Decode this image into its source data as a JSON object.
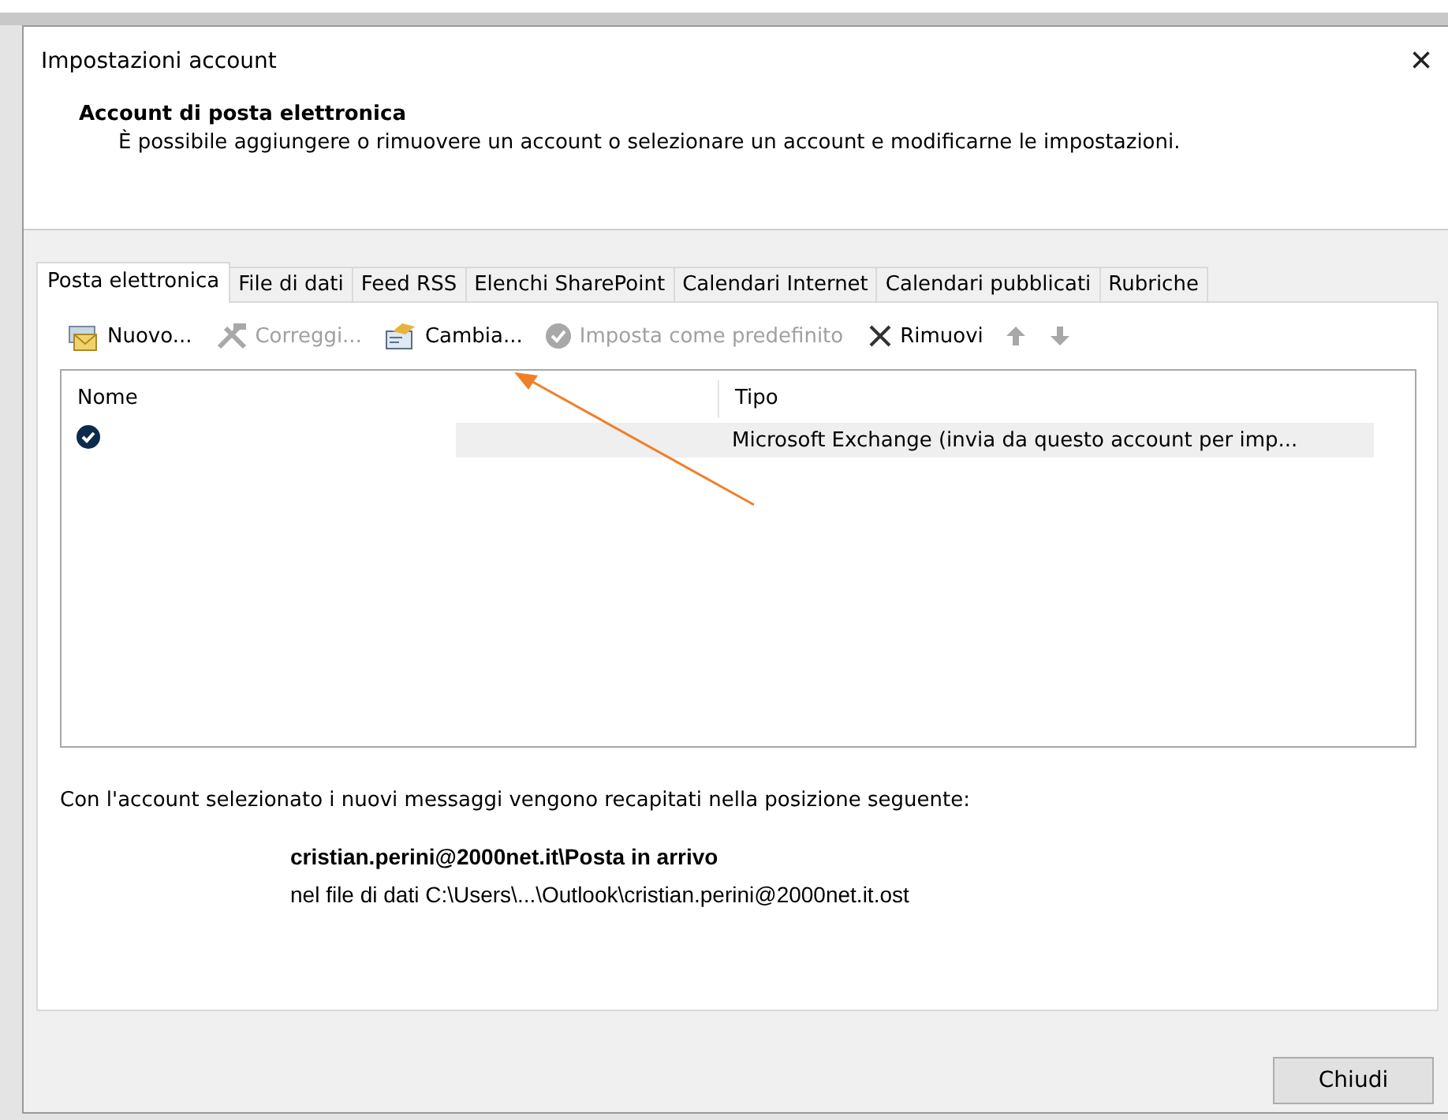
{
  "window": {
    "title": "Impostazioni account",
    "close": "×"
  },
  "header": {
    "title": "Account di posta elettronica",
    "description": "È possibile aggiungere o rimuovere un account o selezionare un account e modificarne le impostazioni."
  },
  "tabs": [
    {
      "label": "Posta elettronica",
      "selected": true
    },
    {
      "label": "File di dati",
      "selected": false
    },
    {
      "label": "Feed RSS",
      "selected": false
    },
    {
      "label": "Elenchi SharePoint",
      "selected": false
    },
    {
      "label": "Calendari Internet",
      "selected": false
    },
    {
      "label": "Calendari pubblicati",
      "selected": false
    },
    {
      "label": "Rubriche",
      "selected": false
    }
  ],
  "toolbar": [
    {
      "kind": "new",
      "label": "Nuovo...",
      "disabled": false
    },
    {
      "kind": "repair",
      "label": "Correggi...",
      "disabled": true
    },
    {
      "kind": "change",
      "label": "Cambia...",
      "disabled": false
    },
    {
      "kind": "default",
      "label": "Imposta come predefinito",
      "disabled": true
    },
    {
      "kind": "remove",
      "label": "Rimuovi",
      "disabled": false
    },
    {
      "kind": "up",
      "disabled": true
    },
    {
      "kind": "down",
      "disabled": true
    }
  ],
  "table": {
    "columns": [
      "Nome",
      "Tipo"
    ],
    "rows": [
      {
        "default": true,
        "selected": true,
        "tipo": "Microsoft Exchange (invia da questo account per imp..."
      }
    ]
  },
  "delivery": {
    "intro": "Con l'account selezionato i nuovi messaggi vengono recapitati nella posizione seguente:",
    "folder": "cristian.perini@2000net.it\\Posta in arrivo",
    "file": "nel file di dati C:\\Users\\...\\Outlook\\cristian.perini@2000net.it.ost"
  },
  "buttons": [
    "Chiudi"
  ]
}
